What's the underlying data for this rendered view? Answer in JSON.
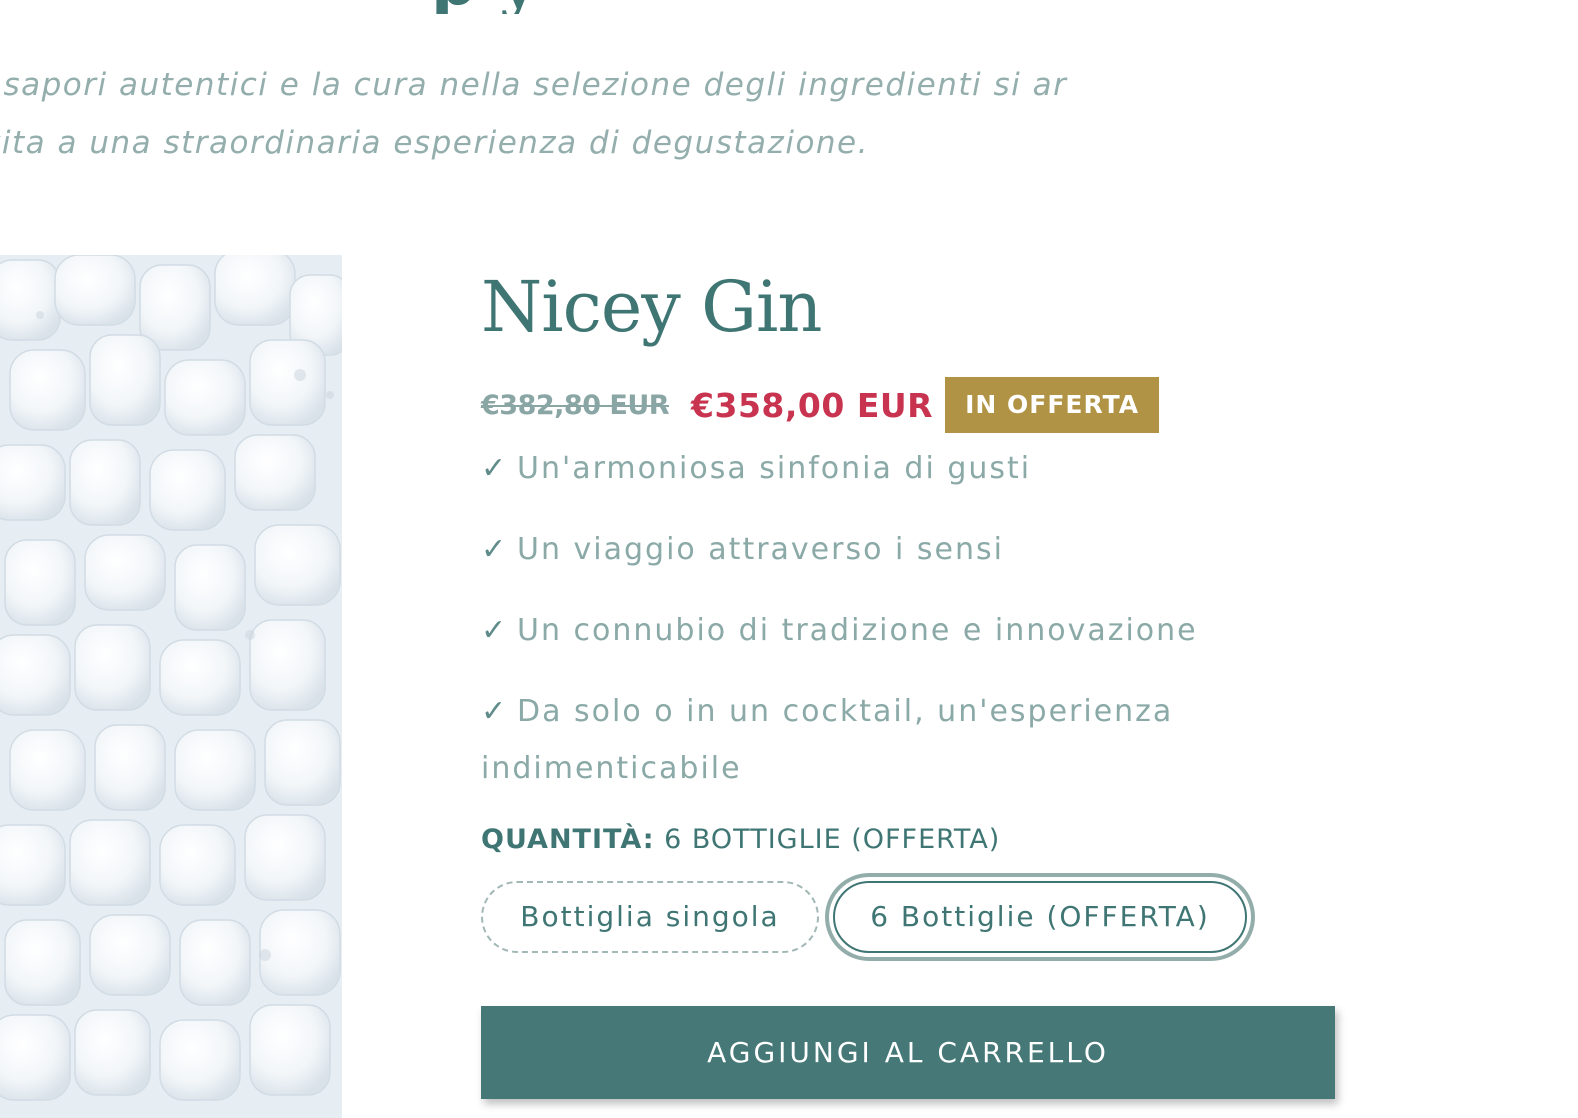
{
  "hero": {
    "title": "p        y",
    "intro": "i sapori autentici e la cura nella selezione degli ingredienti si ar vita a una straordinaria esperienza di degustazione."
  },
  "product": {
    "title": "Nicey Gin",
    "price_compare": "€382,80 EUR",
    "price_sale": "€358,00 EUR",
    "sale_badge": "IN OFFERTA",
    "features": [
      {
        "icon": "check-icon",
        "text": "Un'armoniosa sinfonia di gusti"
      },
      {
        "icon": "check-icon",
        "text": "Un viaggio attraverso i sensi"
      },
      {
        "icon": "check-icon",
        "text": "Un connubio di tradizione e innovazione"
      },
      {
        "icon": "check-icon",
        "text": "Da solo o in un cocktail, un'esperienza indimenticabile"
      }
    ],
    "quantity": {
      "label": "QUANTITÀ:",
      "selected": "6 BOTTIGLIE (OFFERTA)"
    },
    "variants": [
      {
        "label": "Bottiglia singola",
        "selected": false
      },
      {
        "label": "6 Bottiglie (OFFERTA)",
        "selected": true
      }
    ],
    "add_to_cart": "AGGIUNGI AL CARRELLO"
  },
  "colors": {
    "brand_teal": "#457876",
    "sale_red": "#c8344f",
    "badge_gold": "#b09344",
    "muted_text": "#8aa9a7"
  }
}
